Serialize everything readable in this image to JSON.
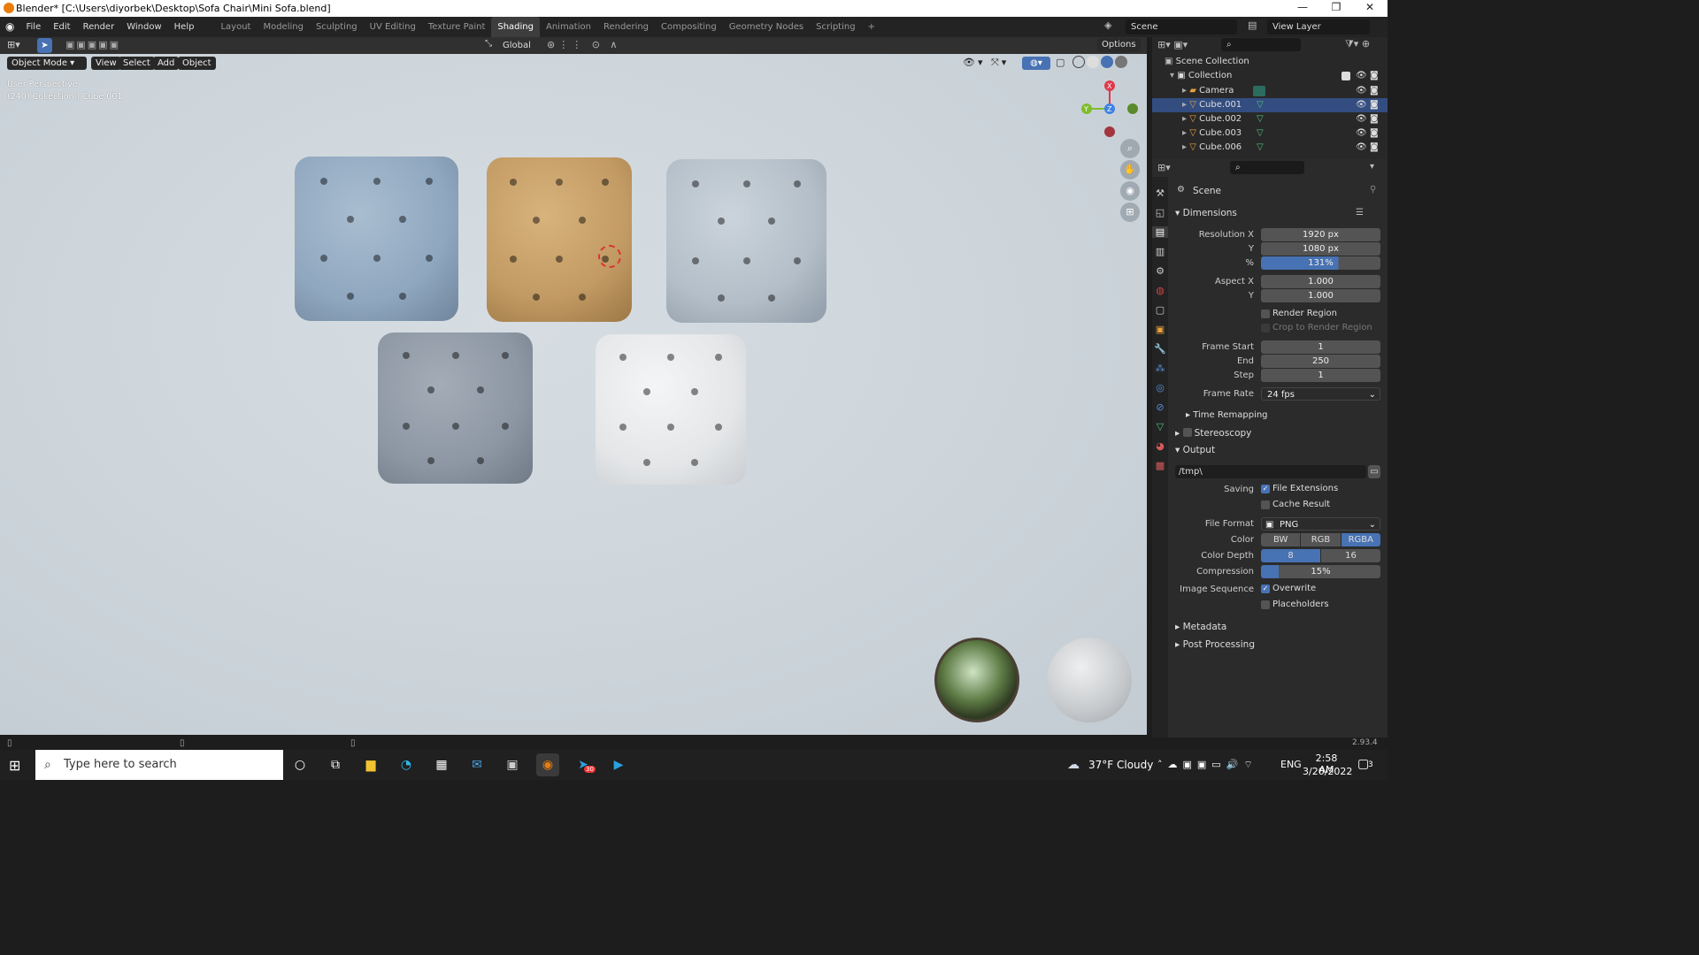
{
  "title": "Blender* [C:\\Users\\diyorbek\\Desktop\\Sofa Chair\\Mini Sofa.blend]",
  "window_controls": {
    "minimize": "—",
    "maximize": "❐",
    "close": "✕"
  },
  "menus": [
    "File",
    "Edit",
    "Render",
    "Window",
    "Help"
  ],
  "workspaces": [
    "Layout",
    "Modeling",
    "Sculpting",
    "UV Editing",
    "Texture Paint",
    "Shading",
    "Animation",
    "Rendering",
    "Compositing",
    "Geometry Nodes",
    "Scripting"
  ],
  "active_workspace": "Shading",
  "add_workspace": "+",
  "scene_name": "Scene",
  "view_layer": "View Layer",
  "toolbar": {
    "transform_orientation": "Global",
    "options": "Options"
  },
  "viewport_header": {
    "mode": "Object Mode",
    "view": "View",
    "select": "Select",
    "add": "Add",
    "object": "Object"
  },
  "viewport_info": {
    "line1": "User Perspective",
    "line2": "(240) Collection | Cube.001"
  },
  "gizmo": {
    "x": "X",
    "y": "Y",
    "z": "Z",
    "x_color": "#e0384a",
    "y_color": "#7fbd2d",
    "z_color": "#3f81e4"
  },
  "poufs": [
    {
      "name": "blue",
      "color": "#8fa7bf"
    },
    {
      "name": "tan",
      "color": "#c29a63"
    },
    {
      "name": "silver",
      "color": "#b3bec8"
    },
    {
      "name": "gray",
      "color": "#8d97a3"
    },
    {
      "name": "white",
      "color": "#e4e6e8"
    }
  ],
  "outliner": {
    "root": "Scene Collection",
    "collection": "Collection",
    "items": [
      "Camera",
      "Cube.001",
      "Cube.002",
      "Cube.003",
      "Cube.006"
    ]
  },
  "properties": {
    "scene": "Scene",
    "dimensions": "Dimensions",
    "resolution_x_label": "Resolution X",
    "resolution_x": "1920 px",
    "resolution_y_label": "Y",
    "resolution_y": "1080 px",
    "percent_label": "%",
    "percent": "131%",
    "aspect_x_label": "Aspect X",
    "aspect_x": "1.000",
    "aspect_y_label": "Y",
    "aspect_y": "1.000",
    "render_region": "Render Region",
    "crop_region": "Crop to Render Region",
    "frame_start_label": "Frame Start",
    "frame_start": "1",
    "end_label": "End",
    "end": "250",
    "step_label": "Step",
    "step": "1",
    "frame_rate_label": "Frame Rate",
    "frame_rate": "24 fps",
    "time_remapping": "Time Remapping",
    "stereoscopy": "Stereoscopy",
    "output": "Output",
    "path": "/tmp\\",
    "saving_label": "Saving",
    "file_extensions": "File Extensions",
    "cache_result": "Cache Result",
    "file_format_label": "File Format",
    "file_format": "PNG",
    "color_label": "Color",
    "color_options": [
      "BW",
      "RGB",
      "RGBA"
    ],
    "color_selected": "RGBA",
    "color_depth_label": "Color Depth",
    "depth_options": [
      "8",
      "16"
    ],
    "depth_selected": "8",
    "compression_label": "Compression",
    "compression": "15%",
    "compression_fraction": 0.15,
    "image_sequence_label": "Image Sequence",
    "overwrite": "Overwrite",
    "placeholders": "Placeholders",
    "metadata": "Metadata",
    "post_processing": "Post Processing"
  },
  "status": {
    "version": "2.93.4"
  },
  "taskbar": {
    "search_placeholder": "Type here to search",
    "weather": "37°F  Cloudy",
    "language": "ENG",
    "time": "2:58 AM",
    "date": "3/20/2022",
    "telegram_badge": "30",
    "notification_count": "3"
  }
}
